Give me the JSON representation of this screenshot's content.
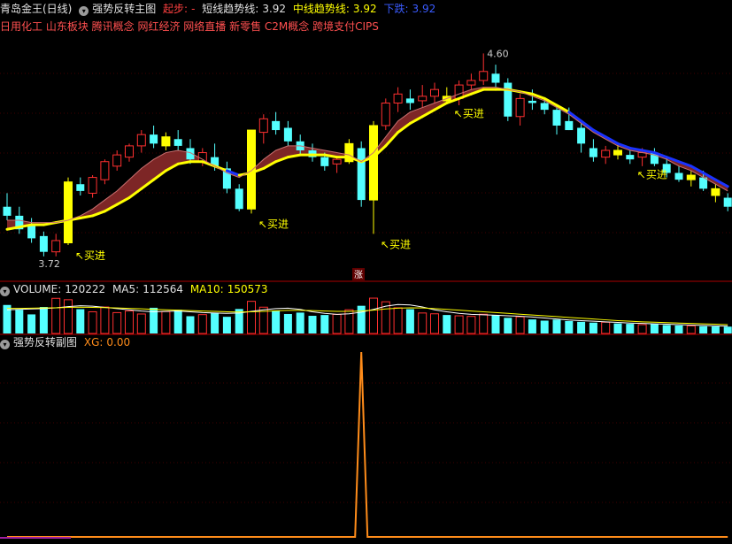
{
  "header": {
    "stock_name": "青岛金王(日线)",
    "indicator_main": "强势反转主图",
    "start_label": "起步:",
    "start_value": "-",
    "short_label": "短线趋势线:",
    "short_value": "3.92",
    "mid_label": "中线趋势线:",
    "mid_value": "3.92",
    "down_label": "下跌:",
    "down_value": "3.92"
  },
  "concepts": "日用化工 山东板块 腾讯概念 网红经济 网络直播 新零售 C2M概念 跨境支付CIPS",
  "divider_badge": "涨",
  "volume_header": {
    "label": "VOLUME:",
    "value": "120222",
    "ma5_label": "MA5:",
    "ma5_value": "112564",
    "ma10_label": "MA10:",
    "ma10_value": "150573"
  },
  "sub_header": {
    "title": "强势反转副图",
    "xg_label": "XG:",
    "xg_value": "0.00"
  },
  "colors": {
    "up": "#ff3030",
    "down": "#54ffff",
    "signal": "#ffff00",
    "trend_up": "#ffff00",
    "trend_down": "#1a33ff",
    "ribbon": "#8b2a2a",
    "xg": "#ff8c1a",
    "grid": "#800000"
  },
  "chart_data": {
    "type": "candlestick",
    "price_labels": {
      "high": "4.60",
      "low": "3.72"
    },
    "buy_label": "买进",
    "candles": [
      {
        "o": 3.92,
        "h": 3.98,
        "l": 3.86,
        "c": 3.88
      },
      {
        "o": 3.88,
        "h": 3.92,
        "l": 3.8,
        "c": 3.82
      },
      {
        "o": 3.84,
        "h": 3.87,
        "l": 3.76,
        "c": 3.78
      },
      {
        "o": 3.79,
        "h": 3.81,
        "l": 3.7,
        "c": 3.72
      },
      {
        "o": 3.72,
        "h": 3.8,
        "l": 3.7,
        "c": 3.77
      },
      {
        "o": 3.76,
        "h": 4.05,
        "l": 3.75,
        "c": 4.03,
        "s": 1
      },
      {
        "o": 4.02,
        "h": 4.05,
        "l": 3.97,
        "c": 3.99
      },
      {
        "o": 3.98,
        "h": 4.06,
        "l": 3.96,
        "c": 4.05
      },
      {
        "o": 4.04,
        "h": 4.13,
        "l": 4.02,
        "c": 4.12
      },
      {
        "o": 4.1,
        "h": 4.17,
        "l": 4.08,
        "c": 4.15
      },
      {
        "o": 4.14,
        "h": 4.2,
        "l": 4.12,
        "c": 4.19
      },
      {
        "o": 4.19,
        "h": 4.26,
        "l": 4.16,
        "c": 4.24
      },
      {
        "o": 4.24,
        "h": 4.28,
        "l": 4.18,
        "c": 4.2
      },
      {
        "o": 4.19,
        "h": 4.25,
        "l": 4.17,
        "c": 4.23,
        "s": 1
      },
      {
        "o": 4.22,
        "h": 4.26,
        "l": 4.17,
        "c": 4.19
      },
      {
        "o": 4.18,
        "h": 4.22,
        "l": 4.11,
        "c": 4.13
      },
      {
        "o": 4.12,
        "h": 4.18,
        "l": 4.1,
        "c": 4.16
      },
      {
        "o": 4.14,
        "h": 4.2,
        "l": 4.08,
        "c": 4.1
      },
      {
        "o": 4.09,
        "h": 4.12,
        "l": 3.98,
        "c": 4.0
      },
      {
        "o": 4.0,
        "h": 4.02,
        "l": 3.9,
        "c": 3.91
      },
      {
        "o": 3.91,
        "h": 4.26,
        "l": 3.89,
        "c": 4.26,
        "s": 1
      },
      {
        "o": 4.25,
        "h": 4.33,
        "l": 4.2,
        "c": 4.31
      },
      {
        "o": 4.3,
        "h": 4.34,
        "l": 4.24,
        "c": 4.26
      },
      {
        "o": 4.27,
        "h": 4.3,
        "l": 4.19,
        "c": 4.21
      },
      {
        "o": 4.21,
        "h": 4.24,
        "l": 4.15,
        "c": 4.17
      },
      {
        "o": 4.17,
        "h": 4.2,
        "l": 4.12,
        "c": 4.14
      },
      {
        "o": 4.14,
        "h": 4.16,
        "l": 4.08,
        "c": 4.1
      },
      {
        "o": 4.11,
        "h": 4.14,
        "l": 4.07,
        "c": 4.13
      },
      {
        "o": 4.12,
        "h": 4.22,
        "l": 4.11,
        "c": 4.2,
        "s": 1
      },
      {
        "o": 4.18,
        "h": 4.21,
        "l": 3.92,
        "c": 3.95
      },
      {
        "o": 3.95,
        "h": 4.3,
        "l": 3.8,
        "c": 4.28,
        "s": 1
      },
      {
        "o": 4.28,
        "h": 4.4,
        "l": 4.26,
        "c": 4.38
      },
      {
        "o": 4.38,
        "h": 4.45,
        "l": 4.34,
        "c": 4.42
      },
      {
        "o": 4.4,
        "h": 4.44,
        "l": 4.35,
        "c": 4.38
      },
      {
        "o": 4.39,
        "h": 4.46,
        "l": 4.36,
        "c": 4.41
      },
      {
        "o": 4.41,
        "h": 4.47,
        "l": 4.38,
        "c": 4.44
      },
      {
        "o": 4.41,
        "h": 4.45,
        "l": 4.38,
        "c": 4.39,
        "s": 1
      },
      {
        "o": 4.4,
        "h": 4.48,
        "l": 4.37,
        "c": 4.46
      },
      {
        "o": 4.46,
        "h": 4.51,
        "l": 4.44,
        "c": 4.48
      },
      {
        "o": 4.48,
        "h": 4.6,
        "l": 4.46,
        "c": 4.52
      },
      {
        "o": 4.51,
        "h": 4.55,
        "l": 4.45,
        "c": 4.47
      },
      {
        "o": 4.47,
        "h": 4.49,
        "l": 4.3,
        "c": 4.32
      },
      {
        "o": 4.32,
        "h": 4.42,
        "l": 4.28,
        "c": 4.4
      },
      {
        "o": 4.39,
        "h": 4.44,
        "l": 4.35,
        "c": 4.38
      },
      {
        "o": 4.38,
        "h": 4.4,
        "l": 4.33,
        "c": 4.35
      },
      {
        "o": 4.35,
        "h": 4.37,
        "l": 4.24,
        "c": 4.28
      },
      {
        "o": 4.3,
        "h": 4.36,
        "l": 4.26,
        "c": 4.26
      },
      {
        "o": 4.27,
        "h": 4.29,
        "l": 4.16,
        "c": 4.2
      },
      {
        "o": 4.18,
        "h": 4.22,
        "l": 4.12,
        "c": 4.14
      },
      {
        "o": 4.14,
        "h": 4.19,
        "l": 4.11,
        "c": 4.17
      },
      {
        "o": 4.17,
        "h": 4.2,
        "l": 4.13,
        "c": 4.15,
        "s": 1
      },
      {
        "o": 4.15,
        "h": 4.17,
        "l": 4.11,
        "c": 4.13
      },
      {
        "o": 4.14,
        "h": 4.18,
        "l": 4.1,
        "c": 4.16
      },
      {
        "o": 4.16,
        "h": 4.18,
        "l": 4.1,
        "c": 4.11
      },
      {
        "o": 4.11,
        "h": 4.14,
        "l": 4.05,
        "c": 4.07
      },
      {
        "o": 4.07,
        "h": 4.1,
        "l": 4.03,
        "c": 4.04
      },
      {
        "o": 4.04,
        "h": 4.08,
        "l": 4.01,
        "c": 4.06,
        "s": 1
      },
      {
        "o": 4.05,
        "h": 4.08,
        "l": 3.99,
        "c": 4.0
      },
      {
        "o": 4.0,
        "h": 4.02,
        "l": 3.94,
        "c": 3.97,
        "s": 1
      },
      {
        "o": 3.96,
        "h": 3.98,
        "l": 3.9,
        "c": 3.92
      }
    ],
    "short_trend": [
      3.86,
      3.86,
      3.85,
      3.85,
      3.85,
      3.86,
      3.88,
      3.91,
      3.95,
      3.99,
      4.04,
      4.09,
      4.13,
      4.16,
      4.17,
      4.16,
      4.13,
      4.1,
      4.07,
      4.05,
      4.08,
      4.13,
      4.17,
      4.19,
      4.19,
      4.18,
      4.17,
      4.16,
      4.15,
      4.12,
      4.16,
      4.23,
      4.3,
      4.34,
      4.36,
      4.38,
      4.4,
      4.42,
      4.44,
      4.45,
      4.45,
      4.44,
      4.43,
      4.41,
      4.39,
      4.36,
      4.33,
      4.29,
      4.25,
      4.22,
      4.19,
      4.17,
      4.16,
      4.15,
      4.13,
      4.1,
      4.08,
      4.05,
      4.02,
      3.99
    ],
    "mid_trend": [
      3.82,
      3.83,
      3.84,
      3.84,
      3.85,
      3.86,
      3.87,
      3.88,
      3.9,
      3.93,
      3.96,
      4.0,
      4.04,
      4.08,
      4.11,
      4.12,
      4.12,
      4.1,
      4.08,
      4.06,
      4.07,
      4.09,
      4.12,
      4.14,
      4.15,
      4.15,
      4.15,
      4.14,
      4.14,
      4.12,
      4.14,
      4.19,
      4.25,
      4.29,
      4.32,
      4.35,
      4.38,
      4.4,
      4.42,
      4.44,
      4.44,
      4.44,
      4.43,
      4.42,
      4.4,
      4.37,
      4.34,
      4.3,
      4.26,
      4.23,
      4.2,
      4.18,
      4.17,
      4.16,
      4.14,
      4.12,
      4.1,
      4.07,
      4.04,
      4.01
    ],
    "down_from": [
      18,
      19,
      46,
      47,
      48,
      49,
      50,
      51,
      52,
      53,
      54,
      55,
      56,
      57,
      58,
      59
    ],
    "buy_signals": [
      5,
      20,
      30,
      36,
      51,
      59
    ],
    "volume": [
      142000,
      118000,
      95000,
      132000,
      175000,
      168000,
      121000,
      108000,
      132000,
      104000,
      112000,
      97000,
      128000,
      109000,
      118000,
      86000,
      94000,
      101000,
      83000,
      122000,
      160000,
      131000,
      112000,
      97000,
      104000,
      88000,
      92000,
      95000,
      118000,
      138000,
      176000,
      158000,
      128000,
      121000,
      102000,
      98000,
      92000,
      88000,
      85000,
      96000,
      91000,
      78000,
      83000,
      70000,
      64000,
      69000,
      62000,
      58000,
      54000,
      56000,
      50000,
      48000,
      44000,
      46000,
      42000,
      40000,
      38000,
      36000,
      35000,
      34000
    ],
    "ma5": [
      118000,
      120000,
      122000,
      124000,
      128000,
      134000,
      138000,
      136000,
      130000,
      124000,
      118000,
      112000,
      108000,
      110000,
      112000,
      108000,
      104000,
      102000,
      100000,
      102000,
      110000,
      118000,
      124000,
      126000,
      120000,
      108000,
      100000,
      95000,
      98000,
      106000,
      120000,
      136000,
      144000,
      142000,
      132000,
      118000,
      108000,
      100000,
      95000,
      93000,
      91000,
      88000,
      86000,
      82000,
      77000,
      72000,
      67000,
      64000,
      61000,
      58000,
      55000,
      52000,
      50000,
      48000,
      46000,
      44000,
      42000,
      40000,
      38000,
      37000
    ],
    "ma10": [
      125000,
      125000,
      126000,
      127000,
      128000,
      130000,
      131000,
      130000,
      129000,
      127000,
      125000,
      123000,
      120000,
      118000,
      116000,
      114000,
      112000,
      110000,
      108000,
      107000,
      108000,
      110000,
      113000,
      115000,
      115000,
      114000,
      112000,
      110000,
      110000,
      112000,
      116000,
      122000,
      126000,
      128000,
      127000,
      124000,
      120000,
      116000,
      112000,
      108000,
      104000,
      100000,
      96000,
      92000,
      88000,
      84000,
      80000,
      76000,
      72000,
      68000,
      64000,
      61000,
      58000,
      56000,
      54000,
      52000,
      50000,
      48000,
      46000,
      44000
    ],
    "xg": [
      0,
      0,
      0,
      0,
      0,
      0,
      0,
      0,
      0,
      0,
      0,
      0,
      0,
      0,
      0,
      0,
      0,
      0,
      0,
      0,
      0,
      0,
      0,
      0,
      0,
      0,
      0,
      0,
      0,
      1,
      0,
      0,
      0,
      0,
      0,
      0,
      0,
      0,
      0,
      0,
      0,
      0,
      0,
      0,
      0,
      0,
      0,
      0,
      0,
      0,
      0,
      0,
      0,
      0,
      0,
      0,
      0,
      0,
      0,
      0
    ],
    "price_range": [
      3.66,
      4.68
    ]
  }
}
